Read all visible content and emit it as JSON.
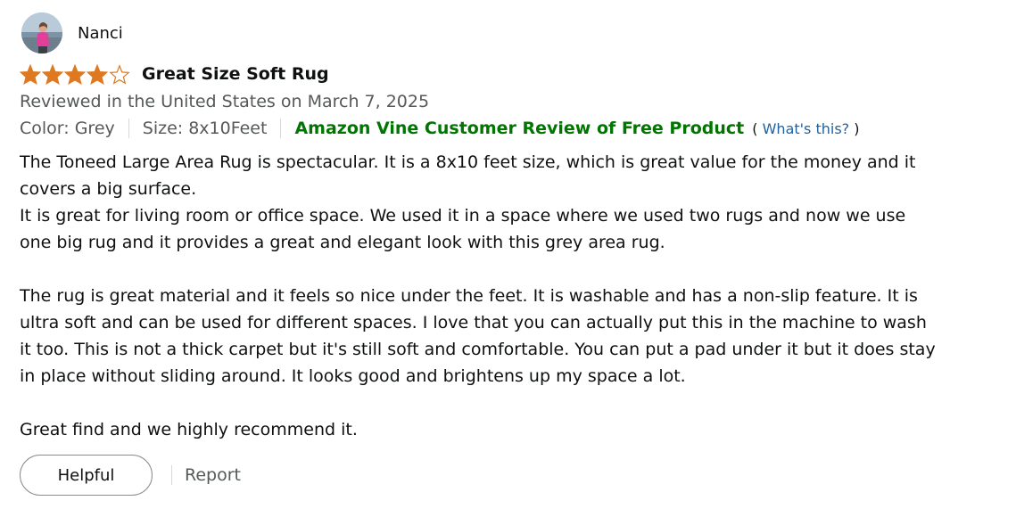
{
  "reviewer": {
    "name": "Nanci",
    "avatar_icon": "profile-photo"
  },
  "rating": {
    "value": 4,
    "max": 5,
    "star_color": "#de7921"
  },
  "title": "Great Size Soft Rug",
  "date_line": "Reviewed in the United States on March 7, 2025",
  "variant": {
    "color": "Color: Grey",
    "size": "Size: 8x10Feet"
  },
  "vine": {
    "label": "Amazon Vine Customer Review of Free Product",
    "open_paren": "(",
    "link": "What's this?",
    "close_paren": ")",
    "color": "#007600"
  },
  "body": {
    "p1": "The Toneed Large Area Rug is spectacular. It is a 8x10 feet size, which is great value for the money and it covers a big surface.",
    "p2": "It is great for living room or office space. We used it in a space where we used two rugs and now we use one big rug and it provides a great and elegant look with this grey area rug.",
    "p3": "The rug is great material and it feels so nice under the feet. It is washable and has a non-slip feature. It is ultra soft and can be used for different spaces. I love that you can actually put this in the machine to wash it too. This is not a thick carpet but it's still soft and comfortable. You can put a pad under it but it does stay in place without sliding around. It looks good and brightens up my space a lot.",
    "p4": "Great find and we highly recommend it."
  },
  "actions": {
    "helpful": "Helpful",
    "report": "Report"
  }
}
